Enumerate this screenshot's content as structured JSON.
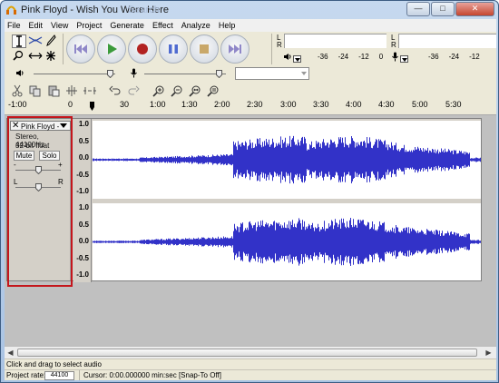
{
  "window": {
    "title": "Pink Floyd - Wish You Were Here",
    "search_hint": "Search",
    "buttons": [
      "minimize",
      "maximize",
      "close"
    ]
  },
  "menubar": {
    "items": [
      {
        "label": "File"
      },
      {
        "label": "Edit"
      },
      {
        "label": "View"
      },
      {
        "label": "Project"
      },
      {
        "label": "Generate"
      },
      {
        "label": "Effect"
      },
      {
        "label": "Analyze"
      },
      {
        "label": "Help"
      }
    ]
  },
  "toolbar": {
    "tools": [
      "selection-tool-icon",
      "envelope-tool-icon",
      "draw-tool-icon",
      "zoom-tool-icon",
      "timeshift-tool-icon",
      "multi-tool-icon"
    ],
    "transport": [
      {
        "name": "skip-start",
        "color": "#8f87c8"
      },
      {
        "name": "play",
        "color": "#3c9b3c"
      },
      {
        "name": "record",
        "color": "#b22222"
      },
      {
        "name": "pause",
        "color": "#4f6bd0"
      },
      {
        "name": "stop",
        "color": "#c9a86a"
      },
      {
        "name": "skip-end",
        "color": "#8f87c8"
      }
    ],
    "meters": {
      "left_label": "L",
      "right_label": "R",
      "playback_ticks": [
        "-36",
        "-24",
        "-12",
        "0"
      ],
      "record_ticks": [
        "-36",
        "-24",
        "-12"
      ],
      "record_ticks_2": [
        "-36",
        "-24",
        "-12"
      ]
    },
    "edit_icons": [
      "cut-icon",
      "copy-icon",
      "paste-icon",
      "trim-icon",
      "silence-icon",
      "undo-icon",
      "redo-icon",
      "zoom-in-icon",
      "zoom-out-icon",
      "fit-selection-icon",
      "fit-project-icon"
    ]
  },
  "ruler": {
    "labels": [
      "-1:00",
      "0",
      "30",
      "1:00",
      "1:30",
      "2:00",
      "2:30",
      "3:00",
      "3:30",
      "4:00",
      "4:30",
      "5:00",
      "5:30"
    ]
  },
  "track": {
    "name": "Pink Floyd -",
    "info_line1": "Stereo, 44100Hz",
    "info_line2": "32-bit float",
    "mute_label": "Mute",
    "solo_label": "Solo",
    "gain_minus": "-",
    "gain_plus": "+",
    "pan_left": "L",
    "pan_right": "R",
    "wave_color": "#3232c8",
    "highlight_color": "#c4161c",
    "vruler_top": [
      "1.0",
      "0.5",
      "0.0",
      "-0.5",
      "-1.0"
    ],
    "vruler_bottom": [
      "1.0",
      "0.5",
      "0.0",
      "-0.5",
      "-1.0"
    ]
  },
  "status": {
    "message": "Click and drag to select audio",
    "project_rate_label": "Project rate:",
    "project_rate_value": "44100",
    "cursor_text": "Cursor: 0:00.000000 min:sec  [Snap-To Off]"
  }
}
